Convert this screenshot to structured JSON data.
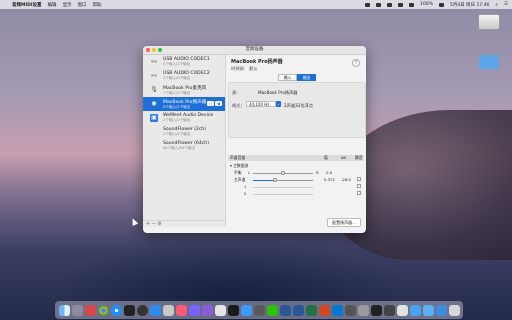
{
  "menubar": {
    "app": "音频MIDI设置",
    "items": [
      "编辑",
      "显示",
      "窗口",
      "帮助"
    ],
    "battery": "100%",
    "clock": "5月4日 周日 17:46"
  },
  "window": {
    "title": "音频设备",
    "devices": [
      {
        "name": "USB AUDIO  CODEC1",
        "sub": "0个输入/2个输出",
        "icon": "usb-icon"
      },
      {
        "name": "USB AUDIO  CODEC2",
        "sub": "2个输入/0个输出",
        "icon": "usb-icon"
      },
      {
        "name": "MacBook Pro麦克风",
        "sub": "1个输入/0个输出",
        "icon": "microphone-icon"
      },
      {
        "name": "MacBook Pro扬声器",
        "sub": "0个输入/2个输出",
        "icon": "speaker-icon"
      },
      {
        "name": "WeMeet Audio Device",
        "sub": "2个输入/2个输出",
        "icon": "wemeet-icon"
      },
      {
        "name": "SoundFlower (2ch)",
        "sub": "2个输入/2个输出",
        "icon": ""
      },
      {
        "name": "SoundFlower (64ch)",
        "sub": "64个输入/64个输出",
        "icon": ""
      }
    ],
    "selected_index": 3,
    "footer": "+ − ⚙",
    "detail": {
      "title": "MacBook Pro扬声器",
      "clock_label": "时钟源：",
      "clock_value": "默认",
      "tab_input": "输入",
      "tab_output": "输出",
      "source_label": "源：",
      "source_value": "MacBook Pro扬声器",
      "format_label": "格式：",
      "format_value": "44,100 Hz",
      "format_channels": "2声道32位浮点",
      "table_headers": [
        "声道音量",
        "值",
        "dB",
        "静音"
      ],
      "master_label": "▾ 主数据流",
      "rows": [
        {
          "label": "平衡",
          "left": "L",
          "right": "R",
          "value": "0.5",
          "db": ""
        },
        {
          "label": "主声道",
          "left": "",
          "right": "",
          "value": "0.372",
          "db": "-26.0"
        },
        {
          "label": "1",
          "left": "",
          "right": "",
          "value": "",
          "db": ""
        },
        {
          "label": "2",
          "left": "",
          "right": "",
          "value": "",
          "db": ""
        }
      ],
      "master_volume_fraction": 0.372,
      "config_button": "配置扬声器..."
    }
  }
}
